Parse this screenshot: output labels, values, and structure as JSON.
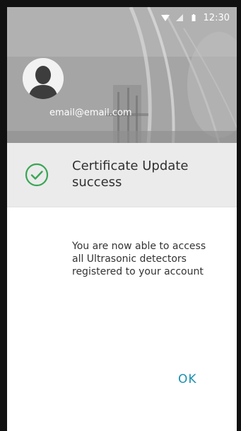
{
  "status_bar": {
    "time": "12:30",
    "icons": [
      "wifi-icon",
      "signal-icon",
      "battery-icon"
    ]
  },
  "profile": {
    "email": "email@email.com",
    "avatar_icon": "user-avatar-icon"
  },
  "certificate": {
    "icon": "check-circle-icon",
    "title": "Certificate Update success"
  },
  "message": {
    "text": "You are now able to access all Ultrasonic detectors registered to your account"
  },
  "actions": {
    "ok_label": "OK"
  },
  "colors": {
    "accent": "#1a8fb0",
    "success": "#3aa655",
    "banner_bg": "#ebebeb"
  }
}
